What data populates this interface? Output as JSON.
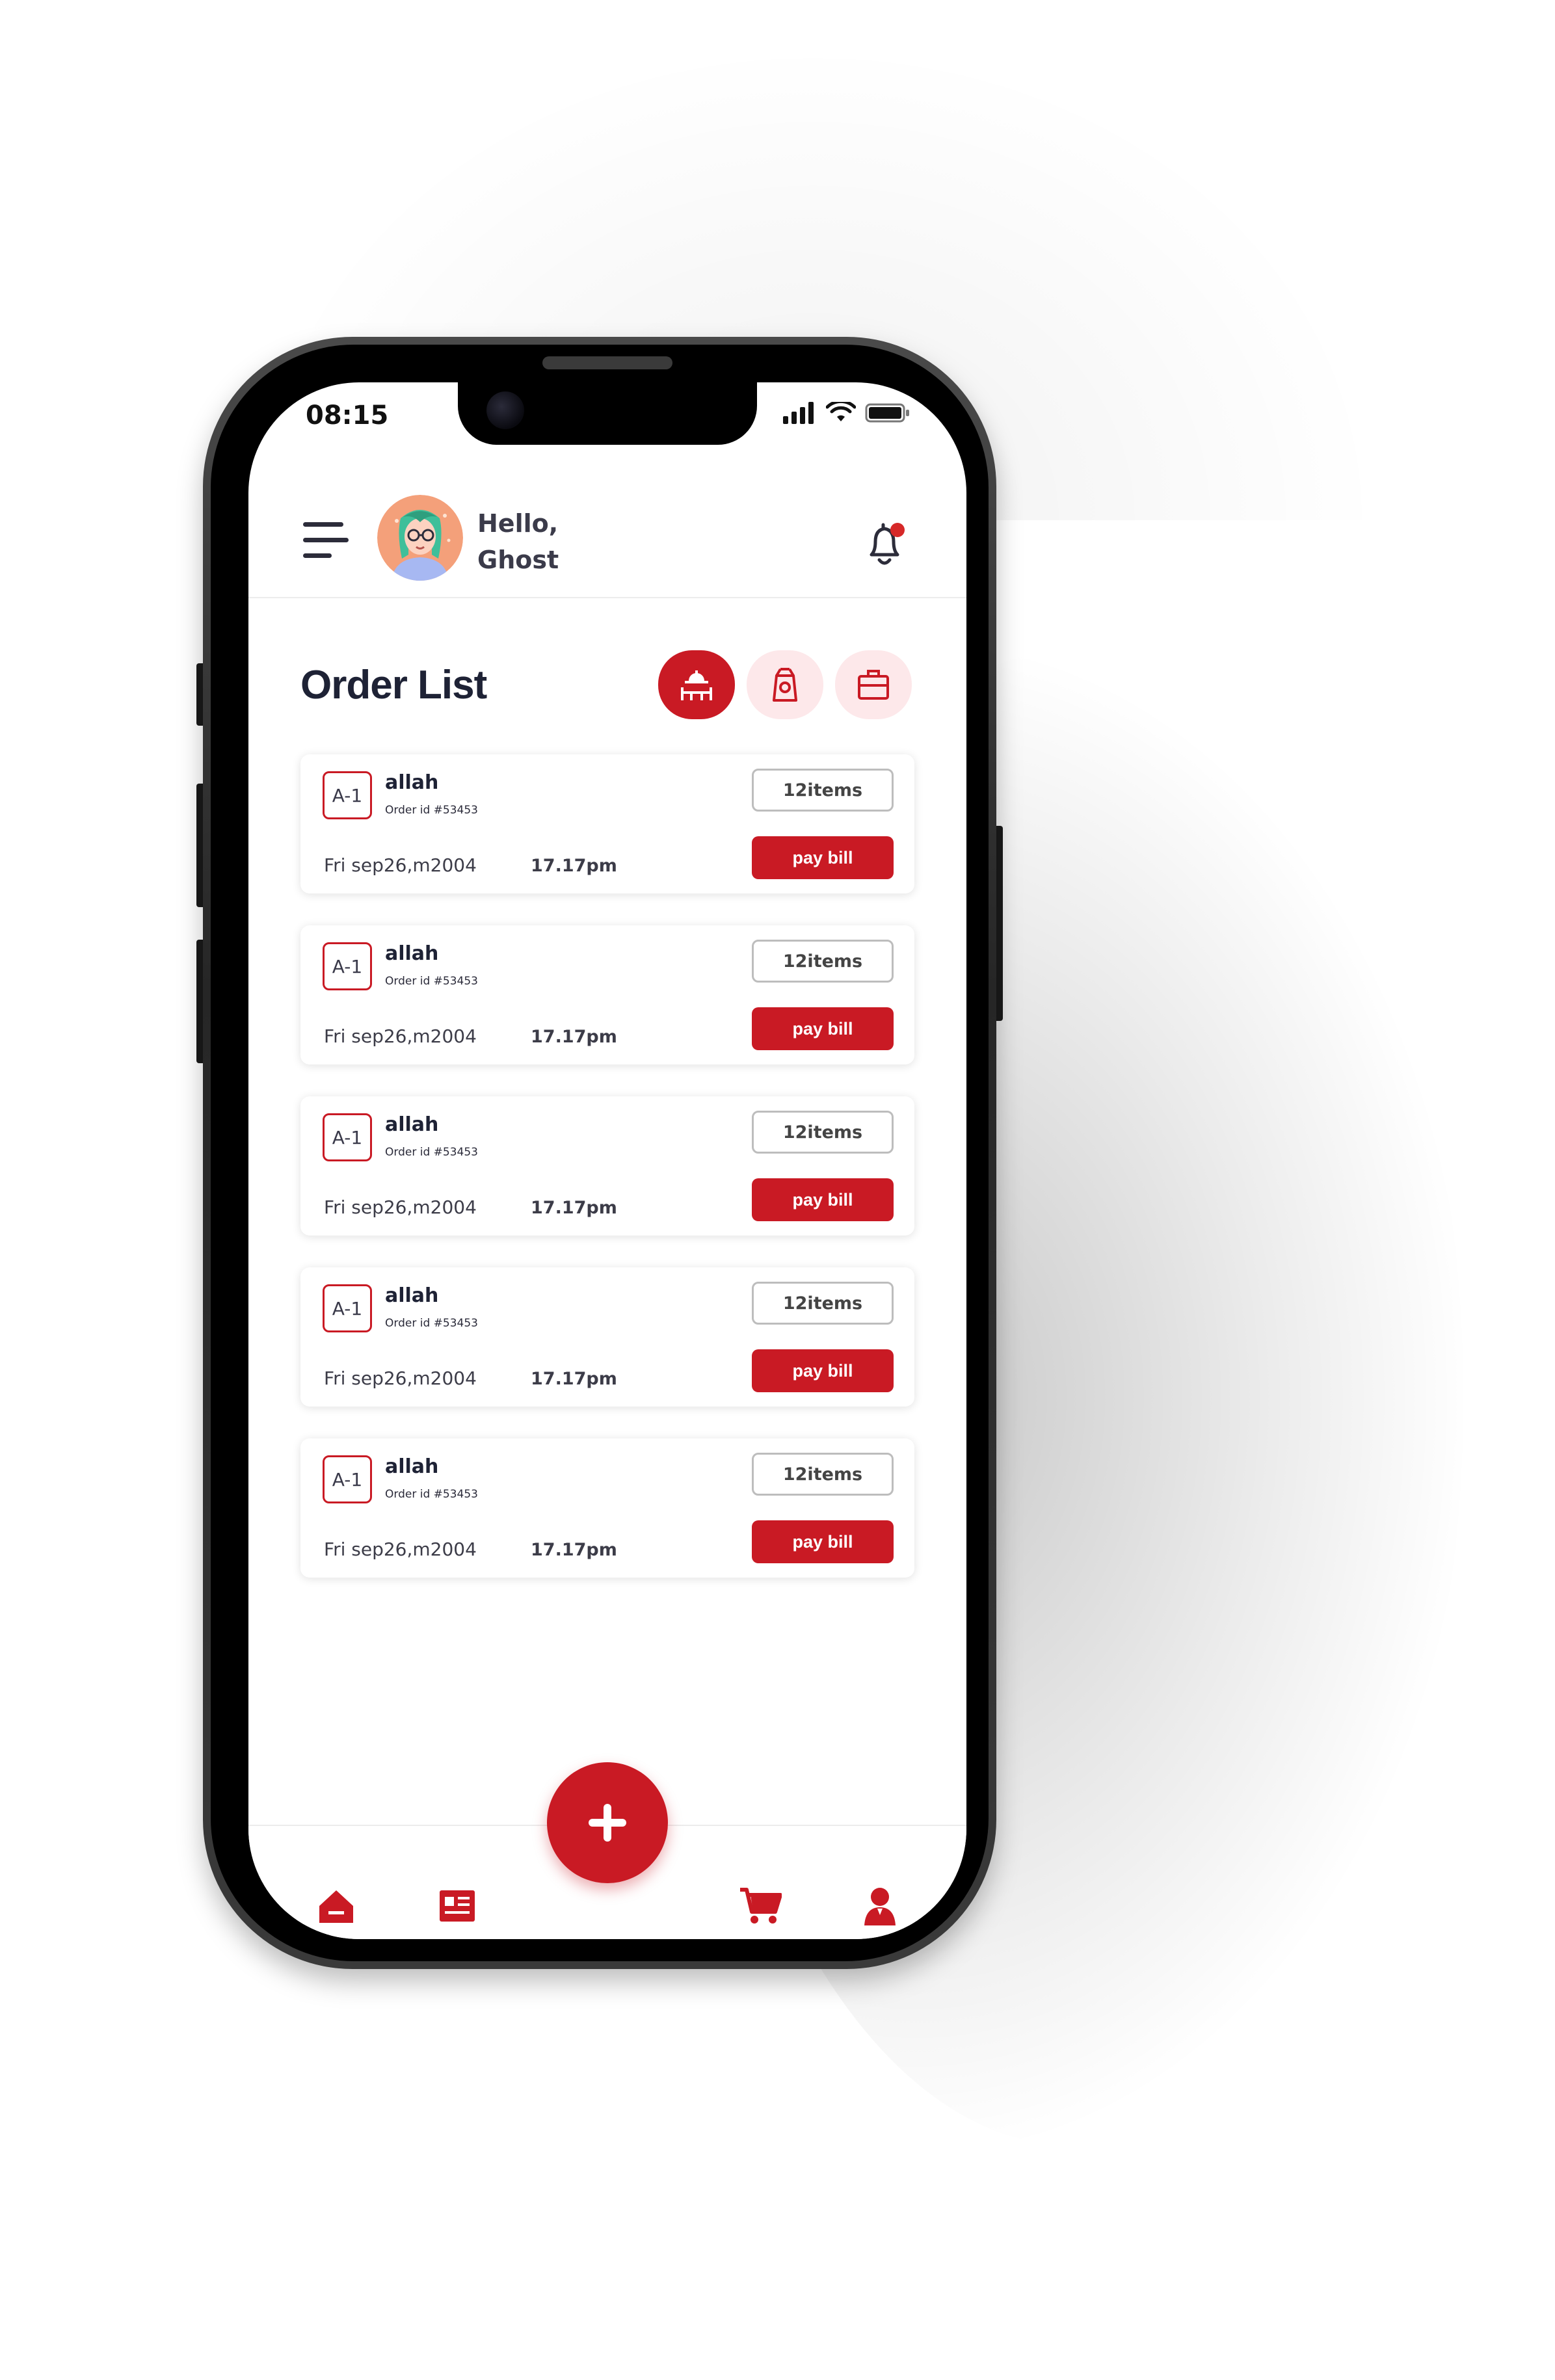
{
  "status_bar": {
    "time": "08:15"
  },
  "header": {
    "greeting": "Hello,",
    "user_name": "Ghost"
  },
  "page": {
    "title": "Order List"
  },
  "filters": [
    {
      "icon": "dine-in-icon",
      "active": true
    },
    {
      "icon": "takeaway-bag-icon",
      "active": false
    },
    {
      "icon": "delivery-box-icon",
      "active": false
    }
  ],
  "orders": [
    {
      "table": "A-1",
      "customer": "allah",
      "order_id": "Order id #53453",
      "items": "12items",
      "date": "Fri sep26,m2004",
      "time": "17.17pm",
      "action": "pay bill"
    },
    {
      "table": "A-1",
      "customer": "allah",
      "order_id": "Order id #53453",
      "items": "12items",
      "date": "Fri sep26,m2004",
      "time": "17.17pm",
      "action": "pay bill"
    },
    {
      "table": "A-1",
      "customer": "allah",
      "order_id": "Order id #53453",
      "items": "12items",
      "date": "Fri sep26,m2004",
      "time": "17.17pm",
      "action": "pay bill"
    },
    {
      "table": "A-1",
      "customer": "allah",
      "order_id": "Order id #53453",
      "items": "12items",
      "date": "Fri sep26,m2004",
      "time": "17.17pm",
      "action": "pay bill"
    },
    {
      "table": "A-1",
      "customer": "allah",
      "order_id": "Order id #53453",
      "items": "12items",
      "date": "Fri sep26,m2004",
      "time": "17.17pm",
      "action": "pay bill"
    }
  ],
  "bottom_nav": {
    "items": [
      "home-icon",
      "orders-list-icon",
      "cart-icon",
      "profile-icon"
    ],
    "fab_icon": "plus-icon"
  },
  "colors": {
    "accent": "#c91a24",
    "accent_light": "#fde8ea",
    "text_dark": "#1e2235"
  }
}
